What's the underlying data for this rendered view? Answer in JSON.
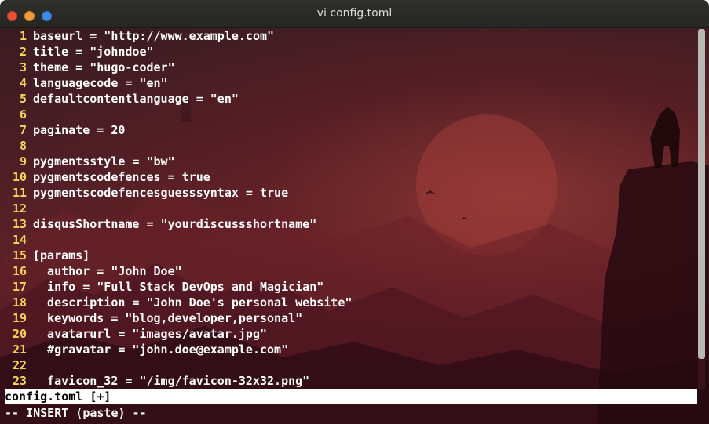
{
  "window": {
    "title": "vi config.toml"
  },
  "editor": {
    "lines": [
      {
        "num": "1",
        "text": "baseurl = \"http://www.example.com\""
      },
      {
        "num": "2",
        "text": "title = \"johndoe\""
      },
      {
        "num": "3",
        "text": "theme = \"hugo-coder\""
      },
      {
        "num": "4",
        "text": "languagecode = \"en\""
      },
      {
        "num": "5",
        "text": "defaultcontentlanguage = \"en\""
      },
      {
        "num": "6",
        "text": ""
      },
      {
        "num": "7",
        "text": "paginate = 20"
      },
      {
        "num": "8",
        "text": ""
      },
      {
        "num": "9",
        "text": "pygmentsstyle = \"bw\""
      },
      {
        "num": "10",
        "text": "pygmentscodefences = true"
      },
      {
        "num": "11",
        "text": "pygmentscodefencesguesssyntax = true"
      },
      {
        "num": "12",
        "text": ""
      },
      {
        "num": "13",
        "text": "disqusShortname = \"yourdiscussshortname\""
      },
      {
        "num": "14",
        "text": ""
      },
      {
        "num": "15",
        "text": "[params]"
      },
      {
        "num": "16",
        "text": "  author = \"John Doe\""
      },
      {
        "num": "17",
        "text": "  info = \"Full Stack DevOps and Magician\""
      },
      {
        "num": "18",
        "text": "  description = \"John Doe's personal website\""
      },
      {
        "num": "19",
        "text": "  keywords = \"blog,developer,personal\""
      },
      {
        "num": "20",
        "text": "  avatarurl = \"images/avatar.jpg\""
      },
      {
        "num": "21",
        "text": "  #gravatar = \"john.doe@example.com\""
      },
      {
        "num": "22",
        "text": ""
      },
      {
        "num": "23",
        "text": "  favicon_32 = \"/img/favicon-32x32.png\""
      }
    ],
    "status_line": "config.toml [+]",
    "mode_line": "-- INSERT (paste) --",
    "scroll_fraction": 0.92
  },
  "colors": {
    "line_number": "#f5d55a",
    "text": "#ffffff",
    "titlebar": "#2b2b28"
  }
}
